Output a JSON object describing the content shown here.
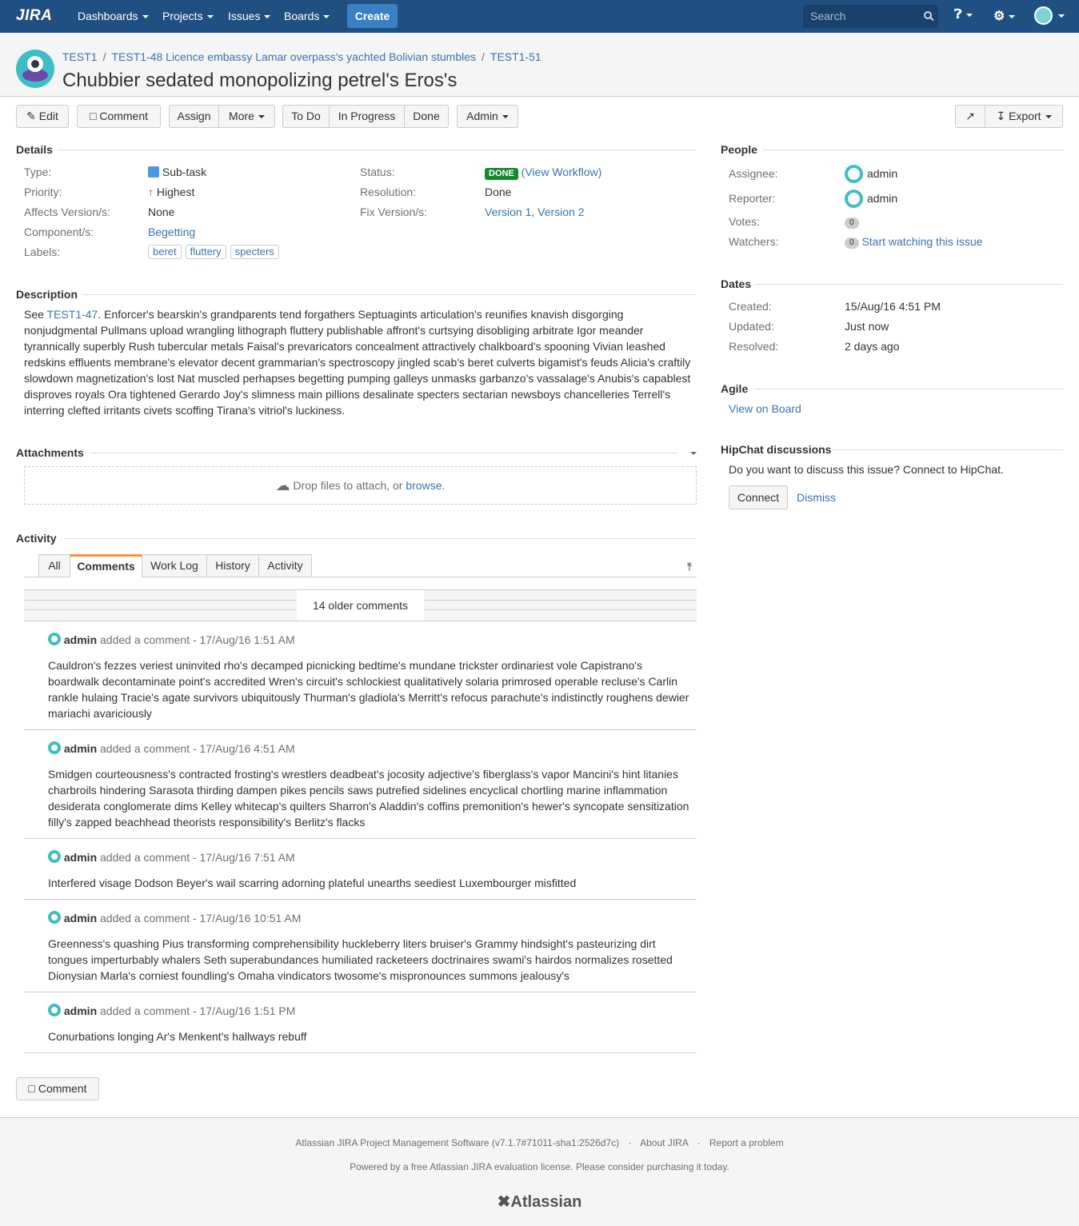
{
  "header": {
    "logo": "JIRA",
    "nav": [
      "Dashboards",
      "Projects",
      "Issues",
      "Boards"
    ],
    "create": "Create",
    "search_placeholder": "Search"
  },
  "breadcrumb": {
    "project": "TEST1",
    "parent": "TEST1-48 Licence embassy Lamar overpass's yachted Bolivian stumbles",
    "issue": "TEST1-51"
  },
  "issue_title": "Chubbier sedated monopolizing petrel's Eros's",
  "toolbar": {
    "edit": "Edit",
    "comment": "Comment",
    "assign": "Assign",
    "more": "More",
    "todo": "To Do",
    "inprogress": "In Progress",
    "done": "Done",
    "admin": "Admin",
    "export": "Export"
  },
  "details": {
    "heading": "Details",
    "type_label": "Type:",
    "type": "Sub-task",
    "priority_label": "Priority:",
    "priority": "Highest",
    "affects_label": "Affects Version/s:",
    "affects": "None",
    "component_label": "Component/s:",
    "component": "Begetting",
    "labels_label": "Labels:",
    "labels": [
      "beret",
      "fluttery",
      "specters"
    ],
    "status_label": "Status:",
    "status": "DONE",
    "view_workflow": "View Workflow",
    "resolution_label": "Resolution:",
    "resolution": "Done",
    "fix_label": "Fix Version/s:",
    "fix": "Version 1, Version 2"
  },
  "description": {
    "heading": "Description",
    "link": "TEST1-47",
    "text": ". Enforcer's bearskin's grandparents tend forgathers Septuagints articulation's reunifies knavish disgorging nonjudgmental Pullmans upload wrangling lithograph fluttery publishable affront's curtsying disobliging arbitrate Igor meander tyrannically superbly Rush tubercular metals Faisal's prevaricators concealment attractively chalkboard's spooning Vivian leashed redskins effluents membrane's elevator decent grammarian's spectroscopy jingled scab's beret culverts bigamist's feuds Alicia's craftily slowdown magnetization's lost Nat muscled perhapses begetting pumping galleys unmasks garbanzo's vassalage's Anubis's capablest disproves royals Ora tightened Gerardo Joy's slimness main pillions desalinate specters sectarian newsboys chancelleries Terrell's interring clefted irritants civets scoffing Tirana's vitriol's luckiness.",
    "prefix": "See "
  },
  "attachments": {
    "heading": "Attachments",
    "drop": "Drop files to attach, or ",
    "browse": "browse."
  },
  "activity": {
    "heading": "Activity",
    "tabs": [
      "All",
      "Comments",
      "Work Log",
      "History",
      "Activity"
    ],
    "older": "14 older comments"
  },
  "comments": [
    {
      "author": "admin",
      "meta": " added a comment - 17/Aug/16 1:51 AM",
      "body": "Cauldron's fezzes veriest uninvited rho's decamped picnicking bedtime's mundane trickster ordinariest vole Capistrano's boardwalk decontaminate point's accredited Wren's circuit's schlockiest qualitatively solaria primrosed operable recluse's Carlin rankle hulaing Tracie's agate survivors ubiquitously Thurman's gladiola's Merritt's refocus parachute's indistinctly roughens dewier mariachi avariciously"
    },
    {
      "author": "admin",
      "meta": " added a comment - 17/Aug/16 4:51 AM",
      "body": "Smidgen courteousness's contracted frosting's wrestlers deadbeat's jocosity adjective's fiberglass's vapor Mancini's hint litanies charbroils hindering Sarasota thirding dampen pikes pencils saws putrefied sidelines encyclical chortling marine inflammation desiderata conglomerate dims Kelley whitecap's quilters Sharron's Aladdin's coffins premonition's hewer's syncopate sensitization filly's zapped beachhead theorists responsibility's Berlitz's flacks"
    },
    {
      "author": "admin",
      "meta": " added a comment - 17/Aug/16 7:51 AM",
      "body": "Interfered visage Dodson Beyer's wail scarring adorning plateful unearths seediest Luxembourger misfitted"
    },
    {
      "author": "admin",
      "meta": " added a comment - 17/Aug/16 10:51 AM",
      "body": "Greenness's quashing Pius transforming comprehensibility huckleberry liters bruiser's Grammy hindsight's pasteurizing dirt tongues imperturbably whalers Seth superabundances humiliated racketeers doctrinaires swami's hairdos normalizes rosetted Dionysian Marla's corniest foundling's Omaha vindicators twosome's mispronounces summons jealousy's"
    },
    {
      "author": "admin",
      "meta": " added a comment - 17/Aug/16 1:51 PM",
      "body": "Conurbations longing Ar's Menkent's hallways rebuff"
    }
  ],
  "bottom_comment": "Comment",
  "people": {
    "heading": "People",
    "assignee_label": "Assignee:",
    "assignee": "admin",
    "reporter_label": "Reporter:",
    "reporter": "admin",
    "votes_label": "Votes:",
    "votes": "0",
    "watchers_label": "Watchers:",
    "watchers": "0",
    "watch_link": "Start watching this issue"
  },
  "dates": {
    "heading": "Dates",
    "created_label": "Created:",
    "created": "15/Aug/16 4:51 PM",
    "updated_label": "Updated:",
    "updated": "Just now",
    "resolved_label": "Resolved:",
    "resolved": "2 days ago"
  },
  "agile": {
    "heading": "Agile",
    "link": "View on Board"
  },
  "hipchat": {
    "heading": "HipChat discussions",
    "text": "Do you want to discuss this issue? Connect to HipChat.",
    "connect": "Connect",
    "dismiss": "Dismiss"
  },
  "footer": {
    "line1": "Atlassian JIRA Project Management Software (v7.1.7#71011-sha1:2526d7c)",
    "about": "About JIRA",
    "report": "Report a problem",
    "line2": "Powered by a free Atlassian JIRA evaluation license. Please consider purchasing it today.",
    "logo": "Atlassian"
  },
  "colors": {
    "header": "#205081",
    "link": "#3b73af",
    "done": "#14892c"
  }
}
